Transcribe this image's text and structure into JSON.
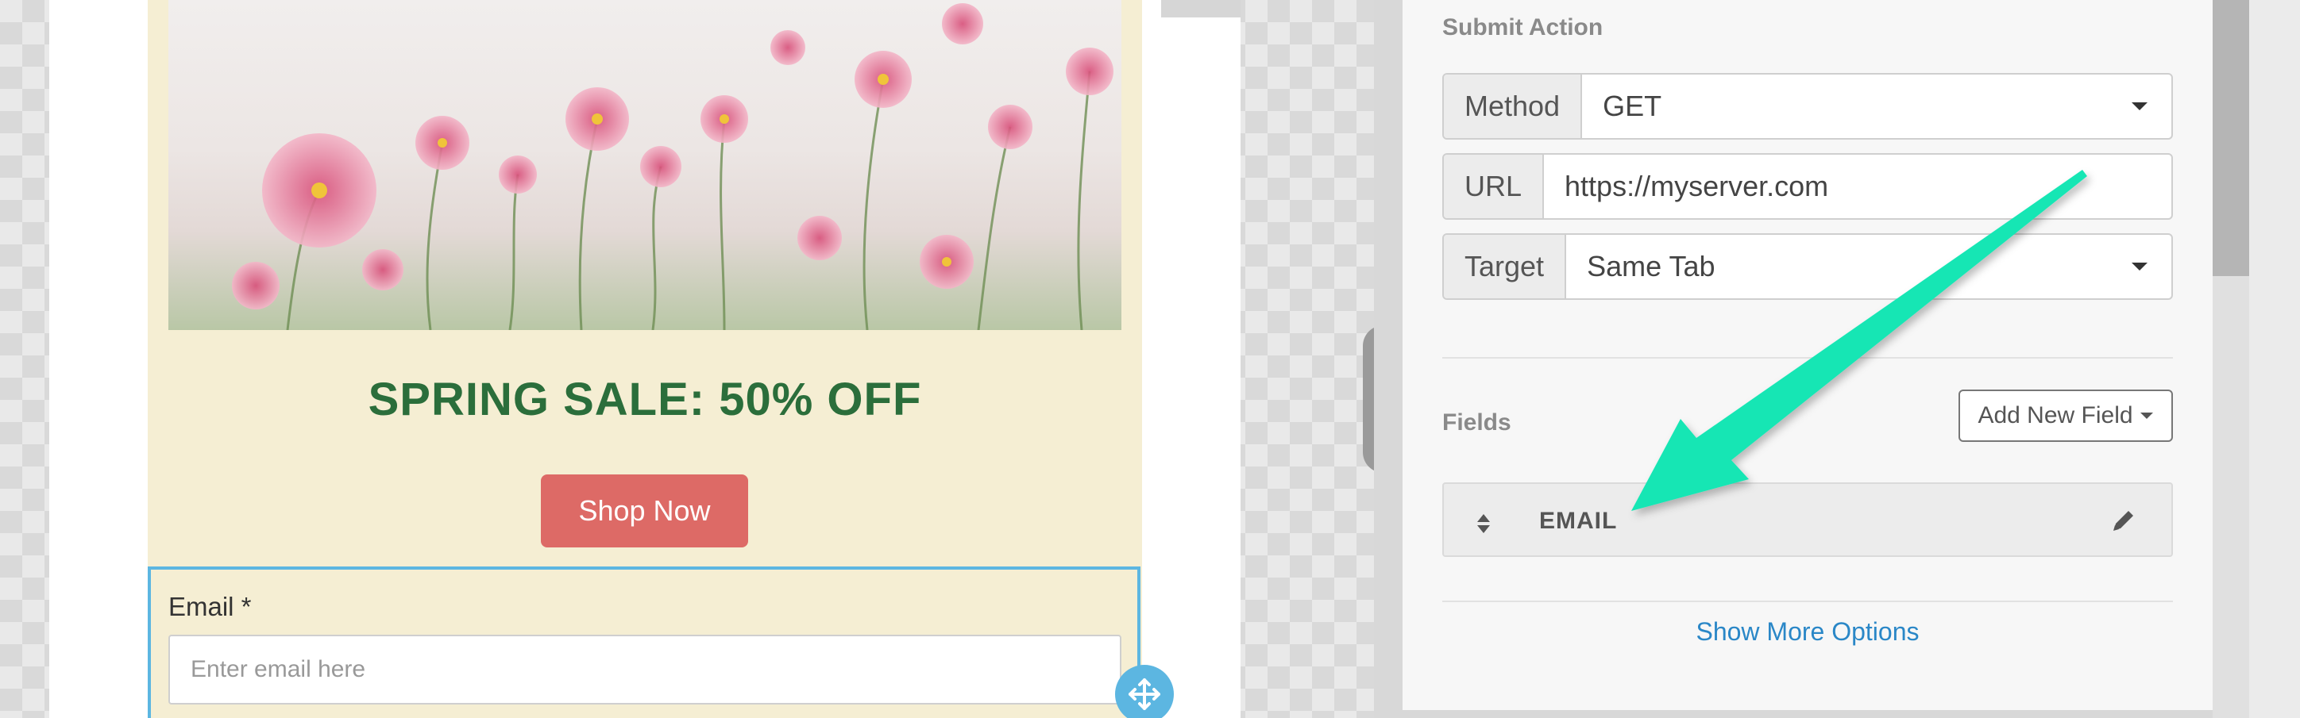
{
  "preview": {
    "hero_image_alt": "",
    "sale_title": "SPRING SALE: 50% OFF",
    "cta_label": "Shop Now",
    "email_label": "Email *",
    "email_placeholder": "Enter email here"
  },
  "panel": {
    "submit_action_title": "Submit Action",
    "method": {
      "label": "Method",
      "value": "GET"
    },
    "url": {
      "label": "URL",
      "value": "https://myserver.com"
    },
    "target": {
      "label": "Target",
      "value": "Same Tab"
    },
    "fields_title": "Fields",
    "add_field_label": "Add New Field",
    "field_items": [
      {
        "name": "EMAIL"
      }
    ],
    "show_more_label": "Show More Options"
  },
  "colors": {
    "email_background": "#f5eed3",
    "sale_title": "#2b6e3b",
    "cta_button": "#dd6a66",
    "selection_border": "#5cb6e1",
    "link": "#2a87c7",
    "annotation_arrow": "#14e6b4"
  },
  "icons": [
    "chevron-right-icon",
    "move-icon",
    "caret-down-icon",
    "sort-icon",
    "pencil-icon",
    "arrow-annotation"
  ]
}
